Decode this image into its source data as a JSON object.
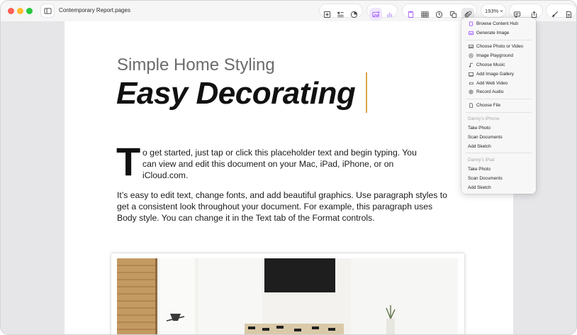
{
  "window": {
    "title": "Contemporary Report.pages",
    "zoom": "193%"
  },
  "document": {
    "subtitle": "Simple Home Styling",
    "title": "Easy Decorating",
    "dropcap": "T",
    "para1_line1": "o get started, just tap or click this placeholder text and begin typing. You",
    "para1_line2": "can view and edit this document on your Mac, iPad, iPhone, or on",
    "para1_line3": "iCloud.com.",
    "para2": "It’s easy to edit text, change fonts, and add beautiful graphics. Use paragraph styles to get a consistent look throughout your document. For example, this paragraph uses Body style. You can change it in the Text tab of the Format controls."
  },
  "media_menu": {
    "browse": "Browse Content Hub",
    "generate": "Generate Image",
    "choose_photo": "Choose Photo or Video",
    "playground": "Image Playground",
    "music": "Choose Music",
    "gallery": "Add Image Gallery",
    "web_video": "Add Web Video",
    "record_audio": "Record Audio",
    "choose_file": "Choose File",
    "iphone_header": "Danny’s iPhone",
    "iphone_take_photo": "Take Photo",
    "iphone_scan": "Scan Documents",
    "iphone_sketch": "Add Sketch",
    "ipad_header": "Danny’s iPad",
    "ipad_take_photo": "Take Photo",
    "ipad_scan": "Scan Documents",
    "ipad_sketch": "Add Sketch"
  },
  "colors": {
    "accent": "#a259ff",
    "caret": "#d7a645"
  }
}
